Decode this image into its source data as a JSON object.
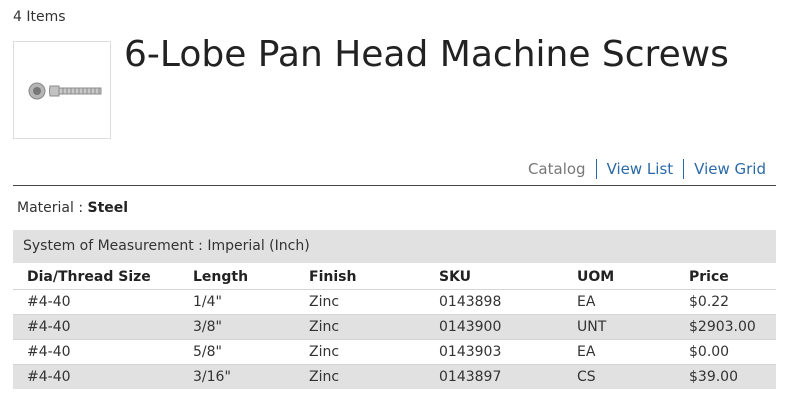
{
  "header": {
    "items_count": "4 Items",
    "title": "6-Lobe Pan Head Machine Screws",
    "thumbnail_icon": "screw-image"
  },
  "views": {
    "catalog": "Catalog",
    "list": "View List",
    "grid": "View Grid"
  },
  "material": {
    "label": "Material :",
    "value": "Steel"
  },
  "group": {
    "system_of_measurement": "System of Measurement : Imperial (Inch)"
  },
  "table": {
    "columns": [
      "Dia/Thread Size",
      "Length",
      "Finish",
      "SKU",
      "UOM",
      "Price"
    ],
    "rows": [
      {
        "dia": "#4-40",
        "length": "1/4\"",
        "finish": "Zinc",
        "sku": "0143898",
        "uom": "EA",
        "price": "$0.22"
      },
      {
        "dia": "#4-40",
        "length": "3/8\"",
        "finish": "Zinc",
        "sku": "0143900",
        "uom": "UNT",
        "price": "$2903.00"
      },
      {
        "dia": "#4-40",
        "length": "5/8\"",
        "finish": "Zinc",
        "sku": "0143903",
        "uom": "EA",
        "price": "$0.00"
      },
      {
        "dia": "#4-40",
        "length": "3/16\"",
        "finish": "Zinc",
        "sku": "0143897",
        "uom": "CS",
        "price": "$39.00"
      }
    ]
  },
  "colors": {
    "link": "#2a6aa8",
    "price": "#f07c2a",
    "band": "#e1e1e1"
  }
}
